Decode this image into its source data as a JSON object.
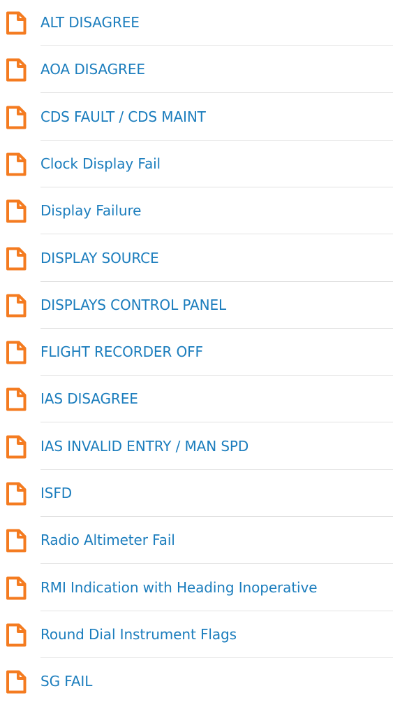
{
  "theme": {
    "accent": "#f47b20",
    "link": "#1b7dbd",
    "divider": "#e2e2e2"
  },
  "list": {
    "icon": "document-icon",
    "items": [
      {
        "label": "ALT DISAGREE"
      },
      {
        "label": "AOA DISAGREE"
      },
      {
        "label": "CDS FAULT / CDS MAINT"
      },
      {
        "label": "Clock Display Fail"
      },
      {
        "label": "Display Failure"
      },
      {
        "label": "DISPLAY SOURCE"
      },
      {
        "label": "DISPLAYS CONTROL PANEL"
      },
      {
        "label": "FLIGHT RECORDER OFF"
      },
      {
        "label": "IAS DISAGREE"
      },
      {
        "label": "IAS INVALID ENTRY / MAN SPD"
      },
      {
        "label": "ISFD"
      },
      {
        "label": "Radio Altimeter Fail"
      },
      {
        "label": "RMI Indication with Heading Inoperative"
      },
      {
        "label": "Round Dial Instrument Flags"
      },
      {
        "label": "SG FAIL"
      }
    ]
  }
}
